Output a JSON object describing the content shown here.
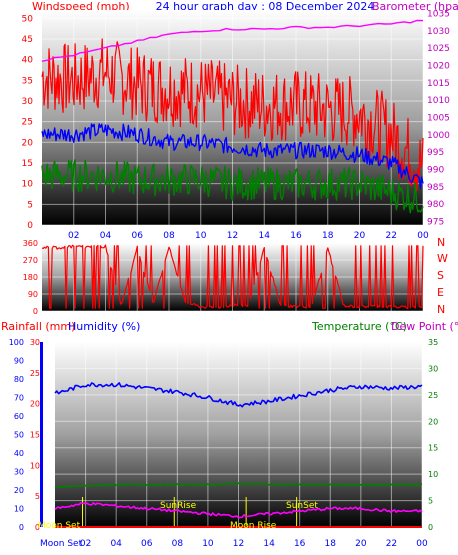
{
  "header": {
    "left_label": "Windspeed (mph)",
    "title": "24 hour graph day : 08 December 2024",
    "right_label": "Barometer (hpa)"
  },
  "direction_labels": [
    "N",
    "W",
    "S",
    "E",
    "N"
  ],
  "lower_header": {
    "rainfall_label": "Rainfall (mm)",
    "humidity_label": "Humidity (%)",
    "temperature_label": "Temperature (°C)",
    "dewpoint_label": "Dew Point (°C)"
  },
  "astro_labels": {
    "moon_set": "Moon Set",
    "sunrise": "SunRise",
    "sunset": "SunSet",
    "moonrise": "Moon Rise"
  },
  "colors": {
    "wind": "#ff0000",
    "wind_avg": "#0000ff",
    "gust_low": "#008000",
    "barometer": "#ff00ff",
    "rainfall": "#ff0000",
    "humidity": "#0000ff",
    "temperature": "#008000",
    "dewpoint": "#ff00ff",
    "astro": "#ffff00",
    "axis_left": "#ff0000",
    "axis_right": "#c000c0",
    "axis_temp": "#008000"
  },
  "chart_data": [
    {
      "type": "line",
      "x_ticks": [
        "02",
        "04",
        "06",
        "08",
        "10",
        "12",
        "14",
        "16",
        "18",
        "20",
        "22",
        "00"
      ],
      "xlim": [
        0,
        24
      ],
      "y_left": {
        "label": "Windspeed (mph)",
        "ticks": [
          0,
          5,
          10,
          15,
          20,
          25,
          30,
          35,
          40,
          45,
          50
        ],
        "ylim": [
          0,
          52
        ]
      },
      "y_right": {
        "label": "Barometer (hpa)",
        "ticks": [
          975,
          980,
          985,
          990,
          995,
          1000,
          1005,
          1010,
          1015,
          1020,
          1025,
          1030,
          1035
        ],
        "ylim": [
          974,
          1036
        ]
      },
      "series": [
        {
          "axis": "left",
          "x": [
            0,
            2,
            4,
            6,
            8,
            10,
            12,
            14,
            16,
            18,
            20,
            22,
            24
          ],
          "values": [
            36,
            35,
            37,
            34,
            33,
            32,
            30,
            29,
            29,
            28,
            27,
            22,
            14
          ]
        },
        {
          "axis": "left",
          "x": [
            0,
            2,
            4,
            6,
            8,
            10,
            12,
            14,
            16,
            18,
            20,
            22,
            24
          ],
          "values": [
            22,
            22,
            23,
            22,
            20,
            20,
            19,
            18,
            18,
            18,
            17,
            15,
            10
          ]
        },
        {
          "axis": "left",
          "x": [
            0,
            2,
            4,
            6,
            8,
            10,
            12,
            14,
            16,
            18,
            20,
            22,
            24
          ],
          "values": [
            12,
            12,
            12,
            11,
            11,
            11,
            10,
            10,
            10,
            10,
            10,
            8,
            6
          ]
        },
        {
          "axis": "right",
          "x": [
            0,
            2,
            4,
            6,
            8,
            10,
            12,
            14,
            16,
            18,
            20,
            22,
            24
          ],
          "values": [
            1021.5,
            1023,
            1025,
            1027,
            1029,
            1030,
            1030.5,
            1030.5,
            1031,
            1031,
            1031.5,
            1032,
            1033
          ]
        }
      ]
    },
    {
      "type": "line",
      "x_ticks": [
        "02",
        "04",
        "06",
        "08",
        "10",
        "12",
        "14",
        "16",
        "18",
        "20",
        "22",
        "00"
      ],
      "xlim": [
        0,
        24
      ],
      "y": {
        "ticks": [
          0,
          90,
          180,
          270,
          360
        ],
        "ylim": [
          0,
          360
        ]
      },
      "series": [
        {
          "x": [
            0,
            1,
            2,
            3,
            4,
            5,
            6,
            7,
            8,
            9,
            10,
            11,
            12,
            13,
            14,
            15,
            16,
            17,
            18,
            19,
            20,
            21,
            22,
            23,
            24
          ],
          "values": [
            345,
            342,
            348,
            346,
            350,
            20,
            345,
            30,
            350,
            40,
            15,
            10,
            25,
            20,
            350,
            20,
            18,
            15,
            345,
            20,
            15,
            18,
            16,
            12,
            15
          ]
        }
      ]
    },
    {
      "type": "line",
      "x_ticks": [
        "02",
        "04",
        "06",
        "08",
        "10",
        "12",
        "14",
        "16",
        "18",
        "20",
        "22",
        "00"
      ],
      "xlim": [
        0,
        24
      ],
      "y_left_rain": {
        "label": "Rainfall (mm)",
        "ticks": [
          0,
          10,
          20,
          30,
          40,
          50,
          60,
          70,
          80,
          90,
          100
        ],
        "ylim": [
          0,
          100
        ]
      },
      "y_left_humidity": {
        "label": "Humidity (%)",
        "ticks": [
          0,
          5,
          10,
          15,
          20,
          25,
          30
        ],
        "ylim": [
          0,
          30
        ]
      },
      "y_right": {
        "label": "Temperature (°C)",
        "ticks": [
          0,
          5,
          10,
          15,
          20,
          25,
          30,
          35
        ],
        "ylim": [
          0,
          35
        ]
      },
      "series": [
        {
          "axis": "humidity",
          "x": [
            0,
            2,
            4,
            6,
            8,
            10,
            12,
            14,
            16,
            18,
            20,
            22,
            24
          ],
          "values": [
            72,
            77,
            77,
            75,
            73,
            70,
            66,
            68,
            71,
            74,
            76,
            75,
            76
          ]
        },
        {
          "axis": "temperature",
          "x": [
            0,
            2,
            4,
            6,
            8,
            10,
            12,
            14,
            16,
            18,
            20,
            22,
            24
          ],
          "values": [
            7.5,
            7.8,
            8,
            8,
            8,
            8,
            8.2,
            8.1,
            8,
            8,
            7.9,
            8,
            8
          ]
        },
        {
          "axis": "temperature",
          "x": [
            0,
            2,
            4,
            6,
            8,
            10,
            12,
            14,
            16,
            18,
            20,
            22,
            24
          ],
          "values": [
            3.5,
            4.5,
            4,
            3.5,
            3,
            2.5,
            2,
            2.5,
            3,
            3.5,
            3.5,
            3,
            3
          ]
        },
        {
          "axis": "rain",
          "x": [
            0,
            24
          ],
          "values": [
            0,
            0
          ]
        }
      ],
      "events": [
        {
          "label": "Moon Set",
          "time": 1.8
        },
        {
          "label": "SunRise",
          "time": 7.8
        },
        {
          "label": "Moon Rise",
          "time": 12.5
        },
        {
          "label": "SunSet",
          "time": 15.8
        }
      ]
    }
  ]
}
